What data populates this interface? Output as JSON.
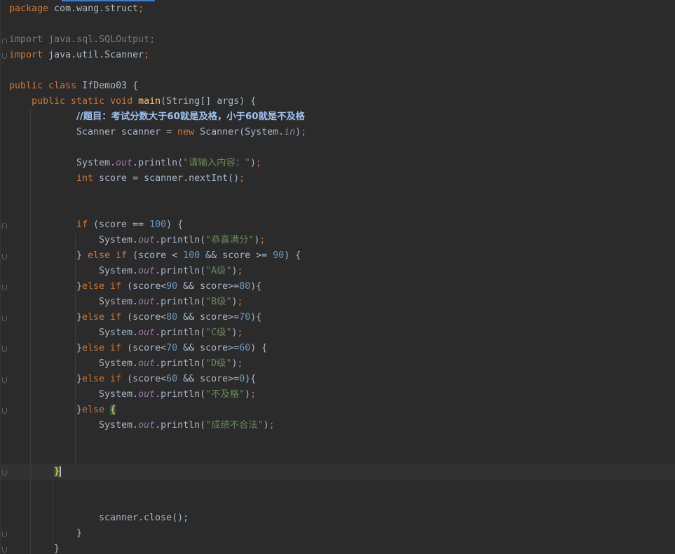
{
  "colors": {
    "background": "#2b2b2b",
    "default_text": "#a9b7c6",
    "keyword": "#cc7832",
    "method_declaration": "#ffc66d",
    "string": "#6a8759",
    "number": "#6897bb",
    "static_field": "#9876aa",
    "comment": "#9cc2f2",
    "unused_import": "#787878",
    "current_line": "#323232",
    "tab_indicator": "#3a7bd5"
  },
  "code": {
    "package_kw": "package",
    "package_name": " com.wang.struct",
    "semicolon": ";",
    "import_kw": "import",
    "import1_name": " java.sql.SQLOutput;",
    "import2_name": " java.util.Scanner",
    "public_class_kw": "public class",
    "class_name": " IfDemo03 {",
    "public_static_void_kw": "public static void",
    "main_name": "main",
    "main_params": "(String[] args) {",
    "comment": "//题目：考试分数大于60就是及格，小于60就是不及格",
    "scanner_decl": "Scanner scanner = ",
    "new_kw": "new",
    "scanner_ctor": " Scanner(System.",
    "in_field": "in",
    "close_paren_semi": ")",
    "system_prefix": "System.",
    "out_field": "out",
    "println_open": ".println(",
    "println_close": ")",
    "prompt_str": "\"请输入内容：\"",
    "int_kw": "int",
    "score_decl": " score = scanner.nextInt()",
    "if_kw": "if",
    "else_if_kw": "else if",
    "else_kw": "else",
    "cond_100": " (score == ",
    "n100": "100",
    "cond_100_end": ") {",
    "str_full": "\"恭喜满分\"",
    "close_brace_space": "} ",
    "cond_a_1": " (score < ",
    "cond_a_2": " && score >= ",
    "n90": "90",
    "cond_a_end": ") {",
    "str_a": "\"A级\"",
    "close_brace": "}",
    "cond_b_1": " (score<",
    "cond_b_2": " && score>=",
    "n80": "80",
    "cond_b_end": "){",
    "str_b": "\"B级\"",
    "n70": "70",
    "str_c": "\"C级\"",
    "n60": "60",
    "cond_d_end": ") {",
    "str_d": "\"D级\"",
    "n0": "0",
    "str_fail": "\"不及格\"",
    "open_brace": "{",
    "str_invalid": "\"成绩不合法\"",
    "close_method_brace": "}",
    "scanner_close": "scanner.close();"
  }
}
